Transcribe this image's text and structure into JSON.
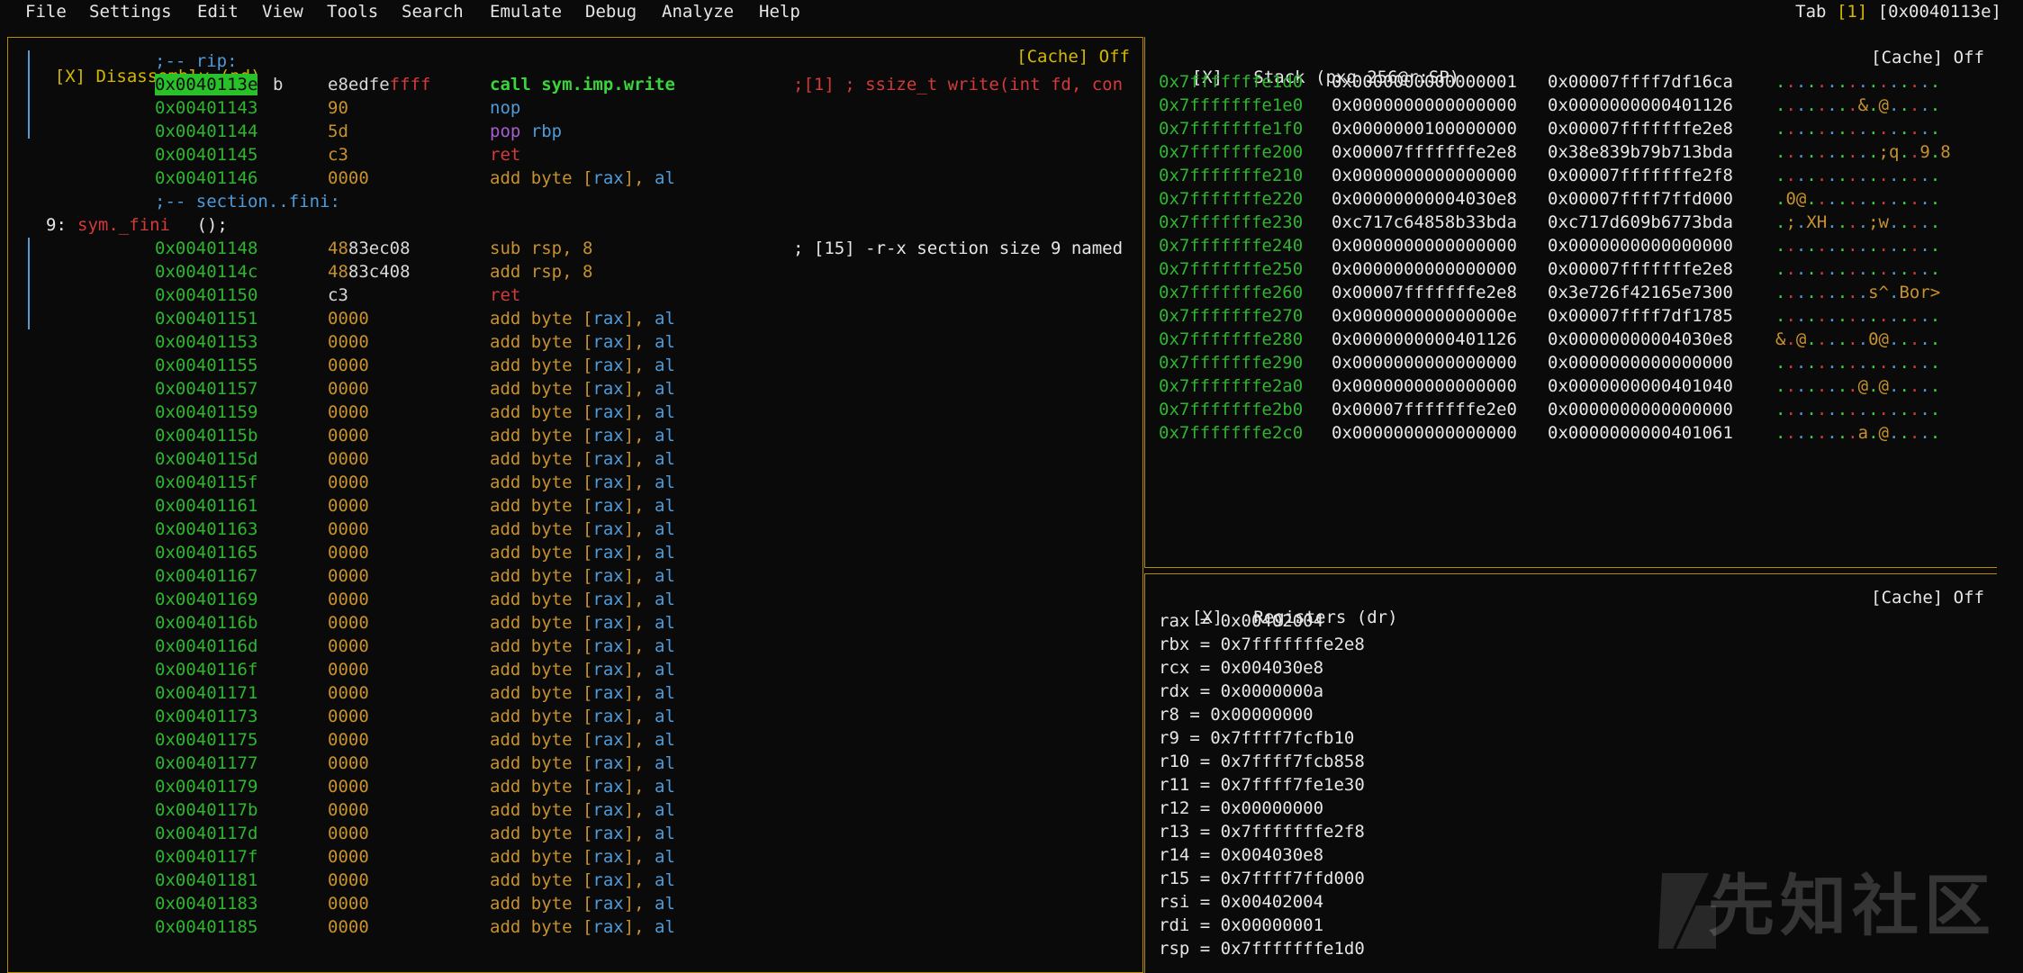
{
  "menu": [
    "File",
    "Settings",
    "Edit",
    "View",
    "Tools",
    "Search",
    "Emulate",
    "Debug",
    "Analyze",
    "Help"
  ],
  "tab": {
    "label": "Tab",
    "index": "[1]",
    "addr": "[0x0040113e]"
  },
  "disasm": {
    "title": "[X] Disassembly (pd)",
    "cache": "[Cache] Off",
    "rip_label": ";-- rip:",
    "first": {
      "addr": "0x0040113e",
      "byte_main": "e8edfe",
      "byte_tail": "ffff",
      "marker": "b",
      "instr": "call sym.imp.write",
      "comment": ";[1] ; ssize_t write(int fd, con"
    },
    "lines1": [
      {
        "addr": "0x00401143",
        "bytes": "90",
        "op": "nop",
        "args": "",
        "cls": "blue"
      },
      {
        "addr": "0x00401144",
        "bytes": "5d",
        "op": "pop",
        "args": "rbp",
        "cls": "purple"
      },
      {
        "addr": "0x00401145",
        "bytes": "c3",
        "op": "ret",
        "args": "",
        "cls": "red"
      },
      {
        "addr": "0x00401146",
        "bytes": "0000",
        "op": "add byte [rax], al",
        "args": "",
        "cls": "gold"
      }
    ],
    "section_label": ";-- section..fini:",
    "func_label": "9: ",
    "func_name": "sym._fini",
    "func_tail": " ();",
    "fini": [
      {
        "addr": "0x00401148",
        "b1": "48",
        "b2": "83ec08",
        "op": "sub",
        "args": "rsp, 8",
        "comment": "; [15] -r-x section size 9 named"
      },
      {
        "addr": "0x0040114c",
        "b1": "48",
        "b2": "83c408",
        "op": "add",
        "args": "rsp, 8",
        "comment": ""
      },
      {
        "addr": "0x00401150",
        "b1": "",
        "b2": "c3",
        "op": "ret",
        "args": "",
        "comment": ""
      }
    ],
    "pad_addrs": [
      "0x00401151",
      "0x00401153",
      "0x00401155",
      "0x00401157",
      "0x00401159",
      "0x0040115b",
      "0x0040115d",
      "0x0040115f",
      "0x00401161",
      "0x00401163",
      "0x00401165",
      "0x00401167",
      "0x00401169",
      "0x0040116b",
      "0x0040116d",
      "0x0040116f",
      "0x00401171",
      "0x00401173",
      "0x00401175",
      "0x00401177",
      "0x00401179",
      "0x0040117b",
      "0x0040117d",
      "0x0040117f",
      "0x00401181",
      "0x00401183",
      "0x00401185"
    ],
    "pad_bytes": "0000",
    "pad_instr": "add byte [rax], al"
  },
  "stack": {
    "title": "[X]   Stack (pxq 256@r:SP)",
    "cache": "[Cache] Off",
    "rows": [
      [
        "0x7fffffffe1d0",
        "0x0000000000000001",
        "0x00007ffff7df16ca",
        "................"
      ],
      [
        "0x7fffffffe1e0",
        "0x0000000000000000",
        "0x0000000000401126",
        "........&.@....."
      ],
      [
        "0x7fffffffe1f0",
        "0x0000000100000000",
        "0x00007fffffffe2e8",
        "................"
      ],
      [
        "0x7fffffffe200",
        "0x00007fffffffe2e8",
        "0x38e839b79b713bda",
        "..........;q..9.8"
      ],
      [
        "0x7fffffffe210",
        "0x0000000000000000",
        "0x00007fffffffe2f8",
        "................"
      ],
      [
        "0x7fffffffe220",
        "0x00000000004030e8",
        "0x00007ffff7ffd000",
        ".0@............."
      ],
      [
        "0x7fffffffe230",
        "0xc717c64858b33bda",
        "0xc717d609b6773bda",
        ".;.XH....;w....."
      ],
      [
        "0x7fffffffe240",
        "0x0000000000000000",
        "0x0000000000000000",
        "................"
      ],
      [
        "0x7fffffffe250",
        "0x0000000000000000",
        "0x00007fffffffe2e8",
        "................"
      ],
      [
        "0x7fffffffe260",
        "0x00007fffffffe2e8",
        "0x3e726f42165e7300",
        ".........s^.Bor>"
      ],
      [
        "0x7fffffffe270",
        "0x000000000000000e",
        "0x00007ffff7df1785",
        "................"
      ],
      [
        "0x7fffffffe280",
        "0x0000000000401126",
        "0x00000000004030e8",
        "&.@......0@....."
      ],
      [
        "0x7fffffffe290",
        "0x0000000000000000",
        "0x0000000000000000",
        "................"
      ],
      [
        "0x7fffffffe2a0",
        "0x0000000000000000",
        "0x0000000000401040",
        "........@.@....."
      ],
      [
        "0x7fffffffe2b0",
        "0x00007fffffffe2e0",
        "0x0000000000000000",
        "................"
      ],
      [
        "0x7fffffffe2c0",
        "0x0000000000000000",
        "0x0000000000401061",
        "........a.@....."
      ]
    ]
  },
  "registers": {
    "title": "[X]   Registers (dr)",
    "cache": "[Cache] Off",
    "rows": [
      "rax = 0x00402004",
      "rbx = 0x7fffffffe2e8",
      "rcx = 0x004030e8",
      "rdx = 0x0000000a",
      "r8 = 0x00000000",
      "r9 = 0x7ffff7fcfb10",
      "r10 = 0x7ffff7fcb858",
      "r11 = 0x7ffff7fe1e30",
      "r12 = 0x00000000",
      "r13 = 0x7fffffffe2f8",
      "r14 = 0x004030e8",
      "r15 = 0x7ffff7ffd000",
      "rsi = 0x00402004",
      "rdi = 0x00000001",
      "rsp = 0x7fffffffe1d0"
    ]
  },
  "watermark": "先知社区"
}
